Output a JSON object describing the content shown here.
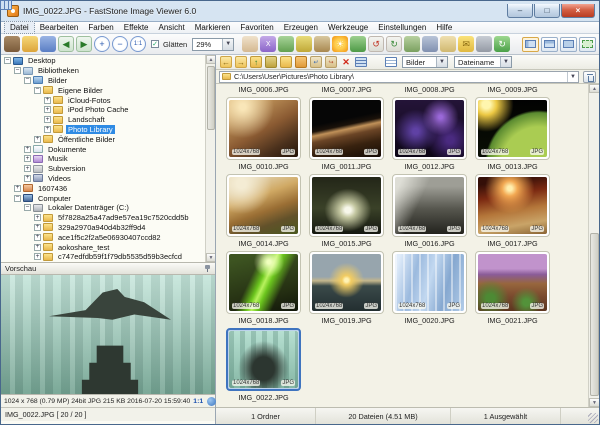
{
  "window": {
    "title": "IMG_0022.JPG  -  FastStone Image Viewer 6.0"
  },
  "menu": {
    "items": [
      "Datei",
      "Bearbeiten",
      "Farben",
      "Effekte",
      "Ansicht",
      "Markieren",
      "Favoriten",
      "Erzeugen",
      "Werkzeuge",
      "Einstellungen",
      "Hilfe"
    ]
  },
  "toolbar": {
    "smooth_label": "Glätten",
    "smooth_checked": "✓",
    "zoom_value": "29%",
    "buttons": [
      "browse",
      "open-file",
      "save-as",
      "previous-image",
      "next-image",
      "zoom-in",
      "zoom-out",
      "actual-size",
      "hand-tool",
      "compare",
      "select",
      "tag",
      "image-strip",
      "effects",
      "red-eye",
      "rotate-left",
      "rotate-right",
      "resize",
      "capture",
      "scan",
      "email",
      "print",
      "update"
    ],
    "layout_buttons": [
      "windowed",
      "browser",
      "full-window",
      "fullscreen"
    ]
  },
  "nav": {
    "filter_value": "Bilder",
    "sort_value": "Dateiname",
    "buttons": [
      "back",
      "forward",
      "up",
      "favorites",
      "copy-to-folder",
      "move-to-folder",
      "copy-file",
      "move-file",
      "delete",
      "view-thumbnails",
      "view-details",
      "view-list"
    ]
  },
  "pathbar": {
    "path": "C:\\Users\\User\\Pictures\\Photo Library\\"
  },
  "tree": {
    "items": [
      {
        "label": "Desktop",
        "depth": 0,
        "exp": "-",
        "icon": "desktop"
      },
      {
        "label": "Bibliotheken",
        "depth": 1,
        "exp": "-",
        "icon": "library"
      },
      {
        "label": "Bilder",
        "depth": 2,
        "exp": "-",
        "icon": "pictures-library"
      },
      {
        "label": "Eigene Bilder",
        "depth": 3,
        "exp": "-",
        "icon": "folder"
      },
      {
        "label": "iCloud-Fotos",
        "depth": 4,
        "exp": "+",
        "icon": "folder"
      },
      {
        "label": "iPod Photo Cache",
        "depth": 4,
        "exp": "+",
        "icon": "folder"
      },
      {
        "label": "Landschaft",
        "depth": 4,
        "exp": "+",
        "icon": "folder"
      },
      {
        "label": "Photo Library",
        "depth": 4,
        "exp": "+",
        "icon": "folder",
        "selected": true
      },
      {
        "label": "Öffentliche Bilder",
        "depth": 3,
        "exp": "+",
        "icon": "folder"
      },
      {
        "label": "Dokumente",
        "depth": 2,
        "exp": "+",
        "icon": "documents-library"
      },
      {
        "label": "Musik",
        "depth": 2,
        "exp": "+",
        "icon": "music-library"
      },
      {
        "label": "Subversion",
        "depth": 2,
        "exp": "+",
        "icon": "folder-grey"
      },
      {
        "label": "Videos",
        "depth": 2,
        "exp": "+",
        "icon": "videos-library"
      },
      {
        "label": "1607436",
        "depth": 1,
        "exp": "+",
        "icon": "user-folder"
      },
      {
        "label": "Computer",
        "depth": 1,
        "exp": "-",
        "icon": "computer"
      },
      {
        "label": "Lokaler Datenträger (C:)",
        "depth": 2,
        "exp": "-",
        "icon": "drive"
      },
      {
        "label": "5f7828a25a47ad9e57ea19c7520cdd5b",
        "depth": 3,
        "exp": "+",
        "icon": "folder"
      },
      {
        "label": "329a2970a940d4b32ff9d4",
        "depth": 3,
        "exp": "+",
        "icon": "folder"
      },
      {
        "label": "ace1f5c2f2a5e06930407ccd82",
        "depth": 3,
        "exp": "+",
        "icon": "folder"
      },
      {
        "label": "aokoshare_test",
        "depth": 3,
        "exp": "+",
        "icon": "folder"
      },
      {
        "label": "c747edfdb59f1f79db5535d59b3ecfcd",
        "depth": 3,
        "exp": "+",
        "icon": "folder"
      }
    ]
  },
  "preview": {
    "header": "Vorschau",
    "info": "1024 x 768 (0.79 MP)  24bit  JPG   215 KB   2016-07-20 15:59:40",
    "zoom": "1:1",
    "file_line": "IMG_0022.JPG [ 20 / 20 ]"
  },
  "grid": {
    "header_labels": [
      "IMG_0006.JPG",
      "IMG_0007.JPG",
      "IMG_0008.JPG",
      "IMG_0009.JPG"
    ],
    "items": [
      {
        "name": "IMG_0010.JPG",
        "dims": "1024x768",
        "fmt": "JPG"
      },
      {
        "name": "IMG_0011.JPG",
        "dims": "1024x768",
        "fmt": "JPG"
      },
      {
        "name": "IMG_0012.JPG",
        "dims": "1024x768",
        "fmt": "JPG"
      },
      {
        "name": "IMG_0013.JPG",
        "dims": "1024x768",
        "fmt": "JPG"
      },
      {
        "name": "IMG_0014.JPG",
        "dims": "1024x768",
        "fmt": "JPG"
      },
      {
        "name": "IMG_0015.JPG",
        "dims": "1024x768",
        "fmt": "JPG"
      },
      {
        "name": "IMG_0016.JPG",
        "dims": "1024x768",
        "fmt": "JPG"
      },
      {
        "name": "IMG_0017.JPG",
        "dims": "1024x768",
        "fmt": "JPG"
      },
      {
        "name": "IMG_0018.JPG",
        "dims": "1024x768",
        "fmt": "JPG"
      },
      {
        "name": "IMG_0019.JPG",
        "dims": "1024x768",
        "fmt": "JPG"
      },
      {
        "name": "IMG_0020.JPG",
        "dims": "1024x768",
        "fmt": "JPG"
      },
      {
        "name": "IMG_0021.JPG",
        "dims": "1024x768",
        "fmt": "JPG"
      },
      {
        "name": "IMG_0022.JPG",
        "dims": "1024x768",
        "fmt": "JPG",
        "selected": true
      }
    ]
  },
  "status": {
    "folders": "1 Ordner",
    "files": "20 Dateien (4.51 MB)",
    "selected": "1 Ausgewählt"
  },
  "colors": {
    "selection_blue": "#2f8be4",
    "thumb_selected_border": "#3f74bf",
    "grid_background": "#f3f2e7"
  }
}
